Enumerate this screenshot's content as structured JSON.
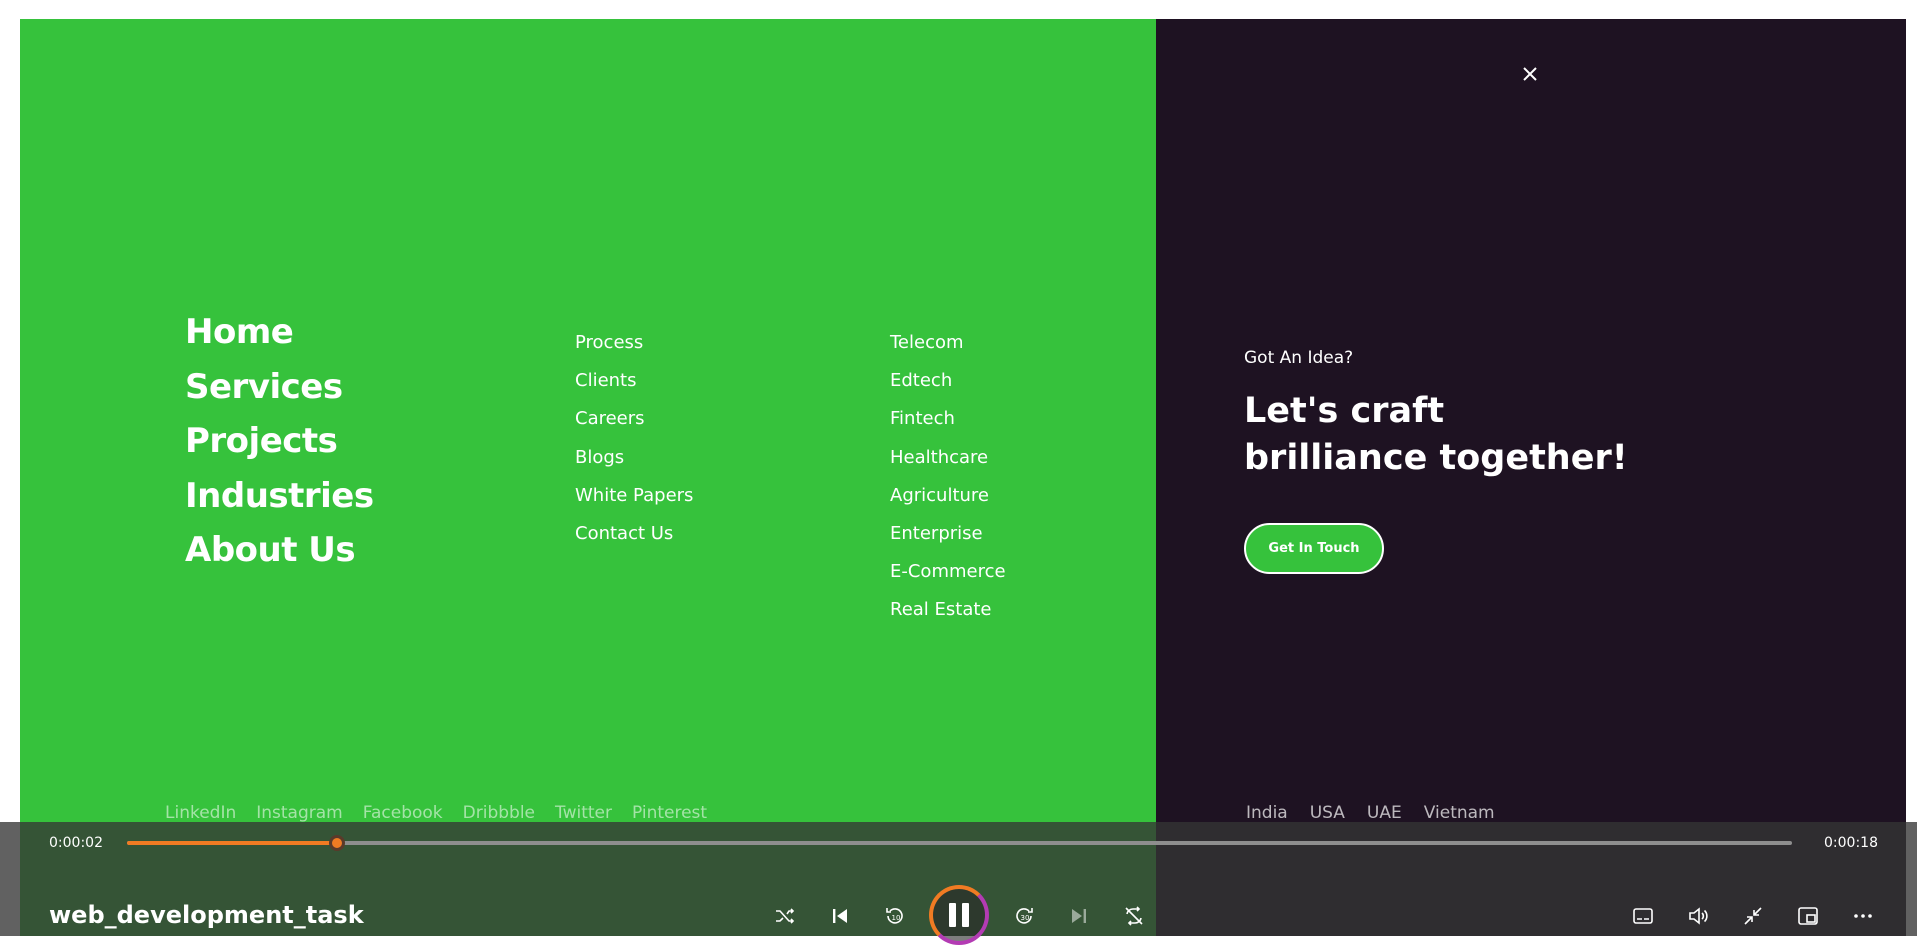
{
  "menu": {
    "main_nav": [
      "Home",
      "Services",
      "Projects",
      "Industries",
      "About Us"
    ],
    "col_a": [
      "Process",
      "Clients",
      "Careers",
      "Blogs",
      "White Papers",
      "Contact Us"
    ],
    "col_b": [
      "Telecom",
      "Edtech",
      "Fintech",
      "Healthcare",
      "Agriculture",
      "Enterprise",
      "E-Commerce",
      "Real Estate"
    ],
    "social": [
      "LinkedIn",
      "Instagram",
      "Facebook",
      "Dribbble",
      "Twitter",
      "Pinterest"
    ]
  },
  "cta_panel": {
    "label": "Got An Idea?",
    "headline_line1": "Let's craft",
    "headline_line2": "brilliance together!",
    "button": "Get In Touch",
    "locations": [
      "India",
      "USA",
      "UAE",
      "Vietnam"
    ]
  },
  "player": {
    "current_time": "0:00:02",
    "total_time": "0:00:18",
    "progress": 0.126,
    "title": "web_development_task",
    "accent_color": "#f07b23"
  },
  "colors": {
    "left_panel": "#36c23c",
    "right_panel": "#1e1222"
  }
}
